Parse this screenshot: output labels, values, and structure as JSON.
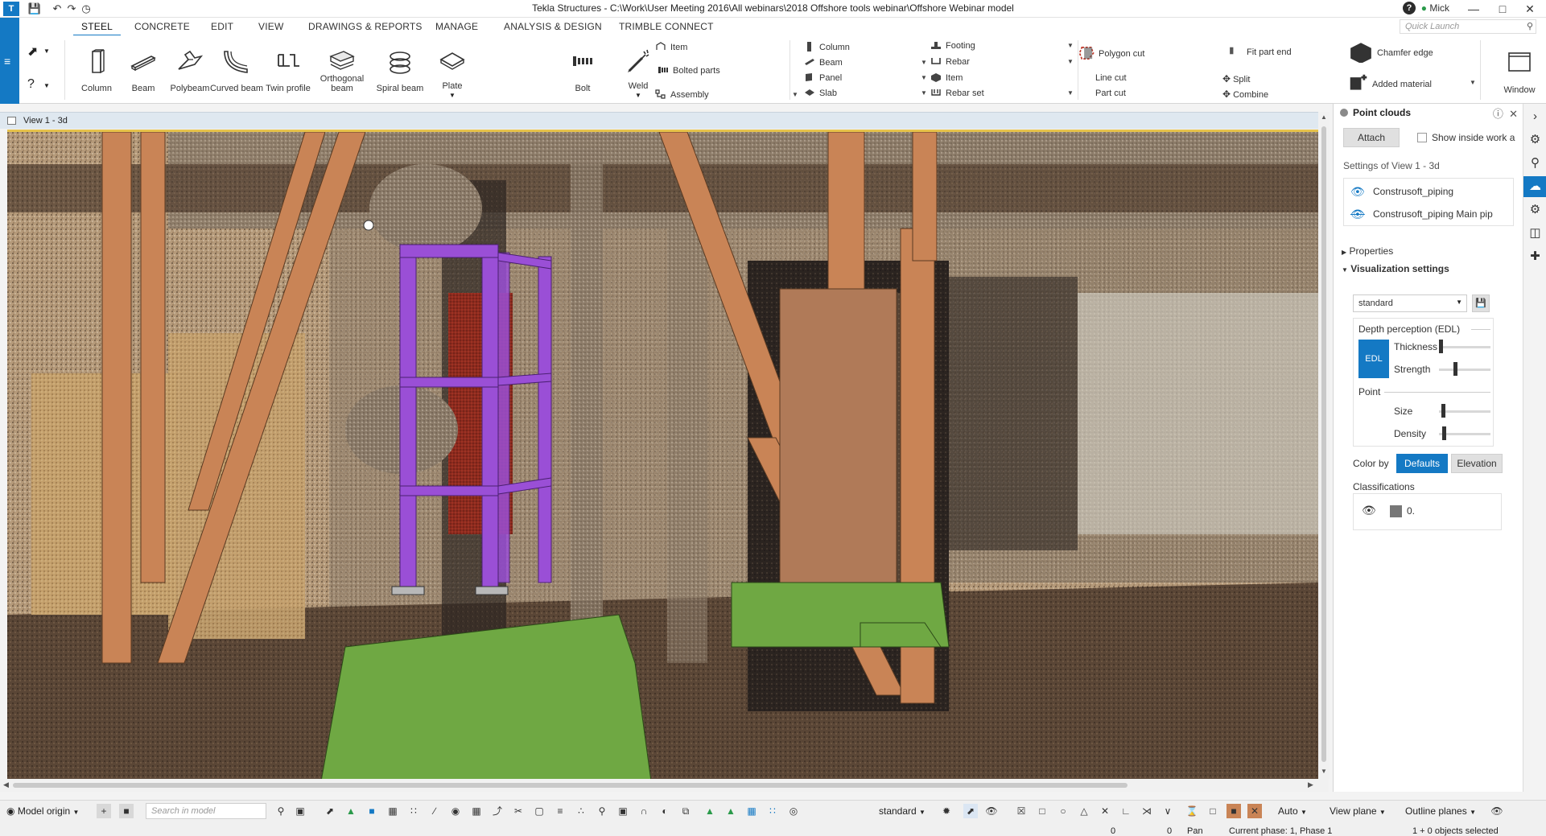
{
  "titlebar": {
    "title": "Tekla Structures - C:\\Work\\User Meeting 2016\\All webinars\\2018 Offshore tools webinar\\Offshore Webinar model",
    "user": "Mick",
    "logo": "T",
    "help": "?"
  },
  "tabs": [
    {
      "label": "STEEL"
    },
    {
      "label": "CONCRETE"
    },
    {
      "label": "EDIT"
    },
    {
      "label": "VIEW"
    },
    {
      "label": "DRAWINGS & REPORTS"
    },
    {
      "label": "MANAGE"
    },
    {
      "label": "ANALYSIS & DESIGN"
    },
    {
      "label": "TRIMBLE CONNECT"
    }
  ],
  "quick_launch": {
    "placeholder": "Quick Launch"
  },
  "ribbon": {
    "big_buttons": [
      {
        "label": "Column",
        "icon": "column-icon"
      },
      {
        "label": "Beam",
        "icon": "beam-icon"
      },
      {
        "label": "Polybeam",
        "icon": "polybeam-icon"
      },
      {
        "label": "Curved beam",
        "icon": "curved-beam-icon"
      },
      {
        "label": "Twin profile",
        "icon": "twin-profile-icon"
      },
      {
        "label": "Orthogonal beam",
        "icon": "orthogonal-beam-icon"
      },
      {
        "label": "Spiral beam",
        "icon": "spiral-beam-icon"
      },
      {
        "label": "Plate",
        "icon": "plate-icon"
      },
      {
        "label": "Bolt",
        "icon": "bolt-icon"
      },
      {
        "label": "Weld",
        "icon": "weld-icon"
      }
    ],
    "steel_small": [
      {
        "label": "Item"
      },
      {
        "label": "Bolted parts"
      },
      {
        "label": "Assembly"
      }
    ],
    "concrete_col1": [
      {
        "label": "Column"
      },
      {
        "label": "Beam"
      },
      {
        "label": "Panel"
      },
      {
        "label": "Slab"
      }
    ],
    "concrete_col2": [
      {
        "label": "Footing"
      },
      {
        "label": "Rebar"
      },
      {
        "label": "Item"
      },
      {
        "label": "Rebar set"
      }
    ],
    "edit_small": [
      {
        "label": "Polygon cut"
      },
      {
        "label": "Line cut"
      },
      {
        "label": "Part cut"
      },
      {
        "label": "Fit part end"
      },
      {
        "label": "Split"
      },
      {
        "label": "Combine"
      },
      {
        "label": "Chamfer edge"
      },
      {
        "label": "Added material"
      }
    ],
    "window_label": "Window"
  },
  "view": {
    "title": "View 1 - 3d"
  },
  "point_clouds_panel": {
    "header": "Point clouds",
    "attach_label": "Attach",
    "show_inside_label": "Show inside work a",
    "settings_of_label": "Settings of View 1 - 3d",
    "clouds": [
      {
        "name": "Construsoft_piping",
        "visible": true
      },
      {
        "name": "Construsoft_piping Main pip",
        "visible": false
      }
    ],
    "properties_label": "Properties",
    "visualization_label": "Visualization settings",
    "preset_value": "standard",
    "depth_perception_label": "Depth perception (EDL)",
    "edl_label": "EDL",
    "thickness_label": "Thickness",
    "strength_label": "Strength",
    "point_label": "Point",
    "size_label": "Size",
    "density_label": "Density",
    "sliders": {
      "thickness": 0.0,
      "strength": 0.3,
      "size": 0.05,
      "density": 0.07
    },
    "color_by_label": "Color by",
    "color_by_options": [
      "Defaults",
      "Elevation"
    ],
    "classifications_label": "Classifications",
    "classification_value": "0."
  },
  "bottombar": {
    "model_origin": "Model origin",
    "search_placeholder": "Search in model",
    "standard": "standard",
    "auto": "Auto",
    "view_plane": "View plane",
    "outline_planes": "Outline planes"
  },
  "statusbar": {
    "val1": "0",
    "val2": "0",
    "mode": "Pan",
    "phase": "Current phase: 1, Phase 1",
    "selection": "1 + 0 objects selected"
  },
  "colors": {
    "accent": "#1479c4",
    "purple_frame": "#9a4fd6",
    "wood_beam": "#c98456"
  }
}
